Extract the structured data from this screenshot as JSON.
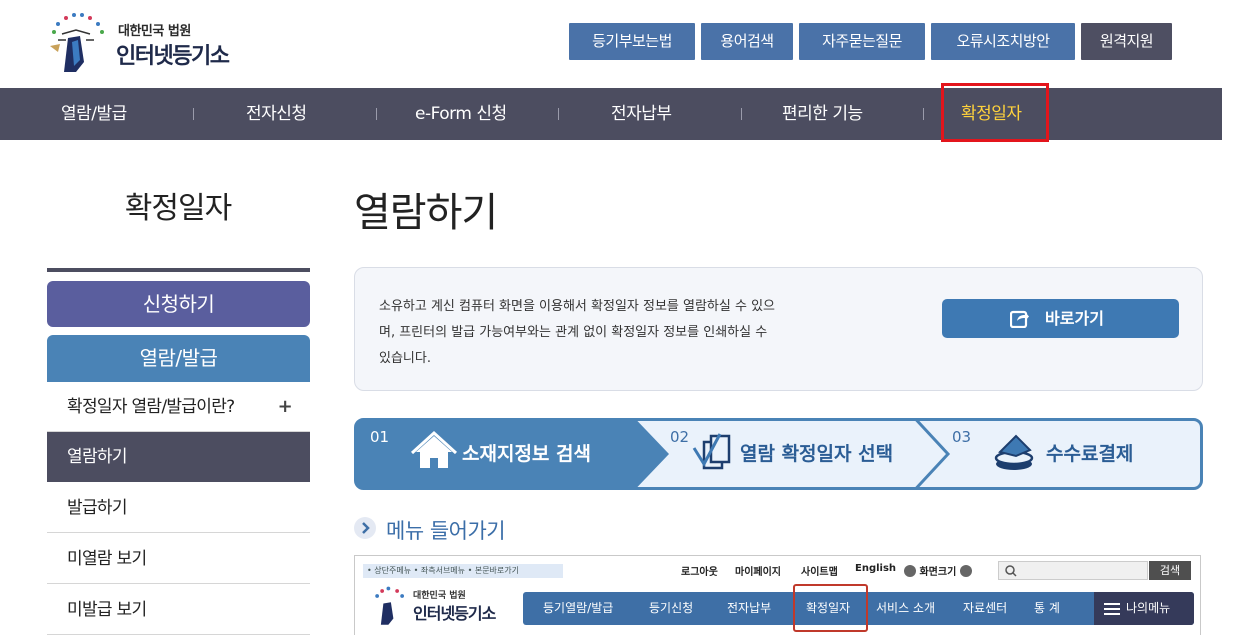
{
  "header": {
    "logo_top": "대한민국 법원",
    "logo_main": "인터넷등기소",
    "util_links": [
      "등기부보는법",
      "용어검색",
      "자주묻는질문",
      "오류시조치방안",
      "원격지원"
    ]
  },
  "gnb": {
    "items": [
      "열람/발급",
      "전자신청",
      "e-Form 신청",
      "전자납부",
      "편리한 기능",
      "확정일자"
    ],
    "active": "확정일자",
    "active_color": "#ffd23c",
    "highlight_color": "#e3151c"
  },
  "sidebar": {
    "title": "확정일자",
    "btn_apply": "신청하기",
    "btn_view": "열람/발급",
    "items": [
      {
        "label": "확정일자 열람/발급이란?",
        "expand": "+"
      },
      {
        "label": "열람하기"
      },
      {
        "label": "발급하기"
      },
      {
        "label": "미열람 보기"
      },
      {
        "label": "미발급 보기"
      }
    ],
    "active_item": "열람하기"
  },
  "main": {
    "title": "열람하기",
    "info_text": "소유하고 계신 컴퓨터 화면을 이용해서 확정일자 정보를 열람하실 수 있으며, 프린터의 발급 가능여부와는 관계 없이 확정일자 정보를 인쇄하실 수 있습니다.",
    "info_lines": [
      "소유하고 계신 컴퓨터 화면을 이용해서 확정일자 정보를 열람하실 수 있으",
      "며, 프린터의 발급 가능여부와는 관계 없이 확정일자 정보를 인쇄하실 수",
      "있습니다."
    ],
    "go_button": "바로가기",
    "steps": [
      {
        "num": "01",
        "label": "소재지정보 검색",
        "icon": "house-icon"
      },
      {
        "num": "02",
        "label": "열람 확정일자 선택",
        "icon": "documents-icon"
      },
      {
        "num": "03",
        "label": "수수료결제",
        "icon": "coins-icon"
      }
    ],
    "menu_enter": "메뉴 들어가기"
  },
  "preview": {
    "skip_links": "• 상단주메뉴 • 좌측서브메뉴 • 본문바로가기",
    "util": [
      "로그아웃",
      "마이페이지",
      "사이트맵",
      "English",
      "화면크기"
    ],
    "search_btn": "검색",
    "logo_top": "대한민국 법원",
    "logo_main": "인터넷등기소",
    "nav": [
      "등기열람/발급",
      "등기신청",
      "전자납부",
      "확정일자",
      "서비스 소개",
      "자료센터",
      "통 계"
    ],
    "my_menu": "나의메뉴"
  }
}
